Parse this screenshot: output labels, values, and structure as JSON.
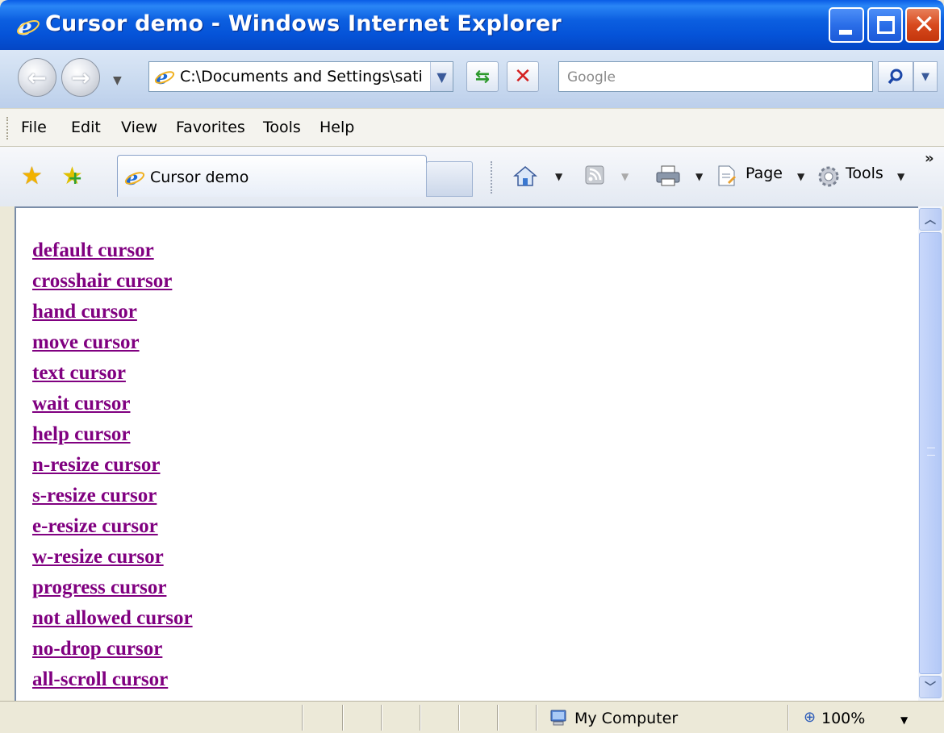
{
  "window": {
    "title": "Cursor demo - Windows Internet Explorer"
  },
  "address_bar": {
    "value": "C:\\Documents and Settings\\sati"
  },
  "search": {
    "placeholder": "Google"
  },
  "menu": {
    "items": [
      "File",
      "Edit",
      "View",
      "Favorites",
      "Tools",
      "Help"
    ]
  },
  "tab": {
    "label": "Cursor demo"
  },
  "toolbar": {
    "page_label": "Page",
    "tools_label": "Tools"
  },
  "content": {
    "links": [
      "default cursor",
      "crosshair cursor",
      "hand cursor",
      "move cursor",
      "text cursor",
      "wait cursor",
      "help cursor",
      "n-resize cursor",
      "s-resize cursor",
      "e-resize cursor",
      "w-resize cursor",
      "progress cursor",
      "not allowed cursor",
      "no-drop cursor",
      "all-scroll cursor"
    ],
    "link_color": "#800080"
  },
  "status": {
    "zone": "My Computer",
    "zoom": "100%"
  },
  "colors": {
    "title_bar": "#0553d8",
    "close_button": "#d84a1e"
  }
}
